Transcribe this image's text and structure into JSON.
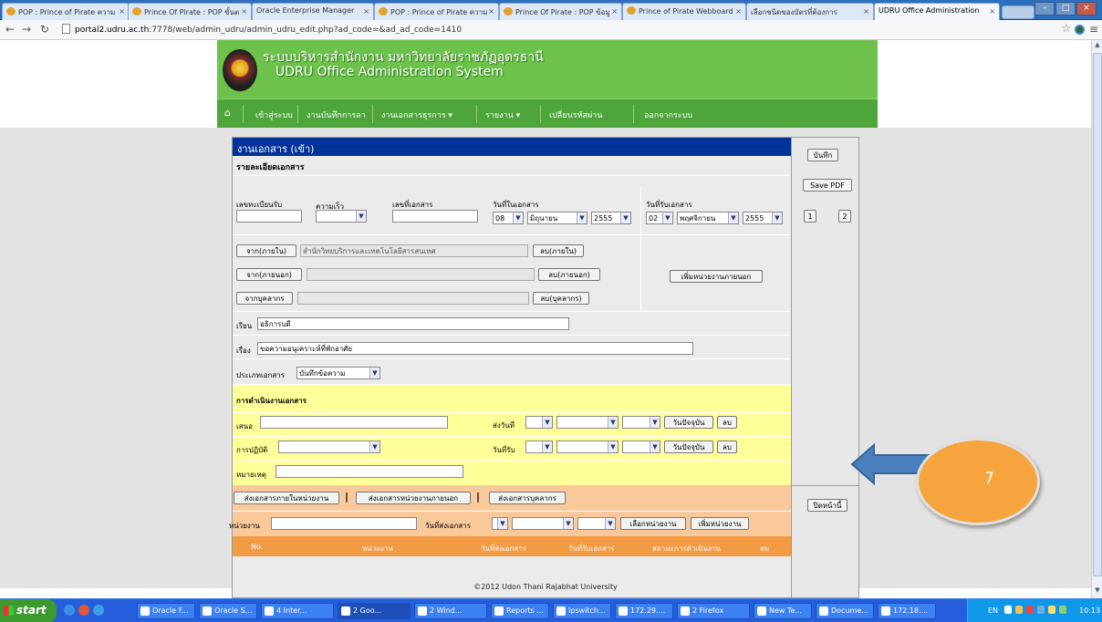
{
  "browser": {
    "tabs": [
      {
        "title": "POP : Prince of Pirate ความ",
        "icon": "pirate-icon"
      },
      {
        "title": "Prince Of Pirate : POP ขั้นต",
        "icon": "pirate-icon"
      },
      {
        "title": "Oracle Enterprise Manager",
        "icon": "page-icon"
      },
      {
        "title": "POP : Prince of Pirate ความ",
        "icon": "pirate-icon"
      },
      {
        "title": "Prince Of Pirate : POP ข้อมู",
        "icon": "pirate-icon"
      },
      {
        "title": "Prince of Pirate Webboard",
        "icon": "pirate-icon"
      },
      {
        "title": "เลือกชนิดของบัตรที่ต้องการ",
        "icon": "page-icon"
      },
      {
        "title": "UDRU Office Administration",
        "icon": "page-icon",
        "active": true
      }
    ],
    "url_domain": "portal2.udru.ac.th",
    "url_rest": ":7778/web/admin_udru/admin_udru_edit.php?ad_code=&ad_ad_code=1410"
  },
  "header": {
    "title_th": "ระบบบริหารสำนักงาน มหาวิทยาลัยราชภัฏอุดรธานี",
    "title_en": "UDRU Office Administration System",
    "nav": [
      "เข้าสู่ระบบ",
      "งานบันทึกการลา",
      "งานเอกสารธุรการ ▾",
      "รายงาน ▾",
      "เปลี่ยนรหัสผ่าน",
      "ออกจากระบบ"
    ]
  },
  "form": {
    "title": "งานเอกสาร (เข้า)",
    "detail_heading": "รายละเอียดเอกสาร",
    "labels": {
      "reg_no": "เลขทะเบียนรับ",
      "speed": "ความเร็ว",
      "doc_no": "เลขที่เอกสาร",
      "doc_date": "วันที่ในเอกสาร",
      "recv_date": "วันที่รับเอกสาร"
    },
    "doc_date": {
      "day": "08",
      "month": "มิถุนายน",
      "year": "2555"
    },
    "recv_date": {
      "day": "02",
      "month": "พฤศจิกายน",
      "year": "2555"
    },
    "from_internal_btn": "จาก(ภายใน)",
    "from_internal_value": "สำนักวิทยบริการและเทคโนโลยีสารสนเทศ",
    "del_internal_btn": "ลบ(ภายใน)",
    "from_external_btn": "จาก(ภายนอก)",
    "del_external_btn": "ลบ(ภายนอก)",
    "add_external_unit_btn": "เพิ่มหน่วยงานภายนอก",
    "from_person_btn": "จากบุคลากร",
    "del_person_btn": "ลบ(บุคลากร)",
    "to_label": "เรียน",
    "to_value": "อธิการบดี",
    "subject_label": "เรื่อง",
    "subject_value": "ขอความอนุเคราะห์ที่พักอาศัย",
    "doctype_label": "ประเภทเอกสาร",
    "doctype_value": "บันทึกข้อความ"
  },
  "process": {
    "heading": "การดำเนินงานเอกสาร",
    "propose_label": "เสนอ",
    "send_date_label": "ส่งวันที่",
    "today_btn": "วันปัจจุบัน",
    "del_btn": "ลบ",
    "action_label": "การปฏิบัติ",
    "recv_date_label": "วันที่รับ",
    "note_label": "หมายเหตุ"
  },
  "dispatch": {
    "send_internal_btn": "ส่งเอกสารภายในหน่วยงาน",
    "send_external_btn": "ส่งเอกสารหน่วยงานภายนอก",
    "send_person_btn": "ส่งเอกสารบุคลากร",
    "unit_label": "หน่วยงาน",
    "send_date_label": "วันที่ส่งเอกสาร",
    "select_unit_btn": "เลือกหน่วยงาน",
    "add_unit_btn": "เพิ่มหน่วยงาน",
    "table_headers": [
      "No.",
      "หน่วยงาน",
      "วันที่ส่งเอกสาร",
      "วันที่รับเอกสาร",
      "สถานะการดำเนินงาน",
      "ลบ"
    ]
  },
  "side": {
    "save_btn": "บันทึก",
    "save_pdf_btn": "Save PDF",
    "pages": [
      "1",
      "2"
    ],
    "close_btn": "ปิดหน้านี้"
  },
  "annotation": {
    "number": "7"
  },
  "footer": "©2012 Udon Thani Rajabhat University",
  "taskbar": {
    "start": "start",
    "items": [
      "Oracle F...",
      "Oracle S...",
      "4 Inter...",
      "2 Goo...",
      "2 Wind...",
      "Reports ...",
      "Ipswitch...",
      "172.29....",
      "2 Firefox",
      "New Te...",
      "Docume...",
      "172.18...."
    ],
    "lang": "EN",
    "clock": "10:13"
  }
}
